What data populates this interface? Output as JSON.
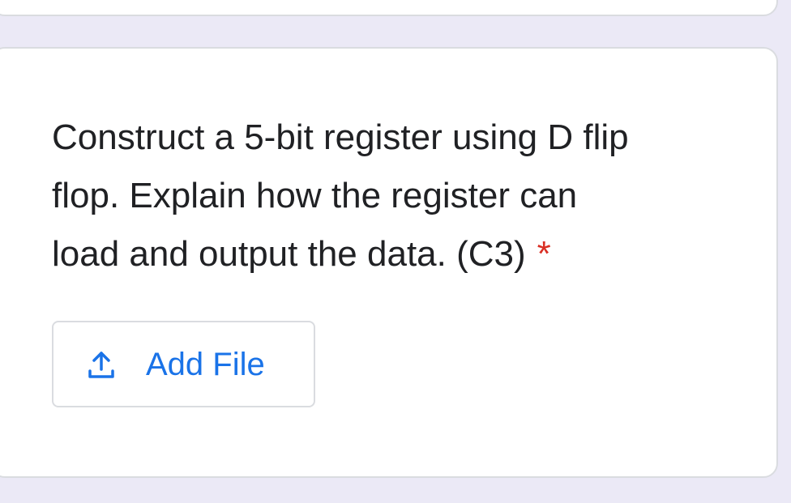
{
  "question": {
    "text": "Construct a 5-bit register using D flip flop. Explain how the register can load and output the data. (C3)",
    "line1": "Construct a 5-bit register using D flip",
    "line2": "flop. Explain how the register can",
    "line3": "load and output the data. (C3)",
    "required_marker": "*"
  },
  "upload": {
    "button_label": "Add File",
    "icon": "upload-icon"
  },
  "colors": {
    "page_background": "#ebe9f6",
    "card_background": "#ffffff",
    "card_border": "#dadce0",
    "text": "#202124",
    "required": "#d93025",
    "accent": "#1a73e8"
  }
}
